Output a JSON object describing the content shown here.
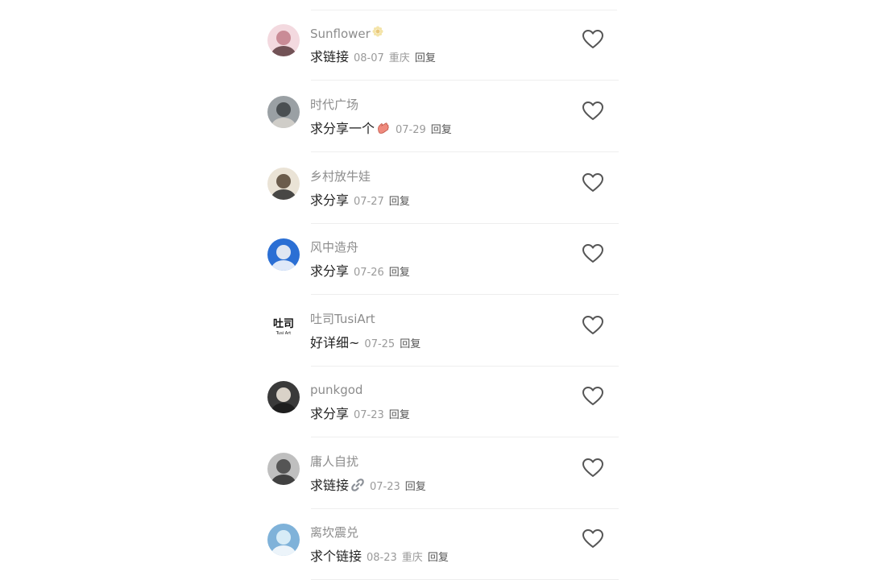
{
  "comments": [
    {
      "username": "Sunflower",
      "username_emoji": "sunflower-emoji-icon",
      "text": "求链接",
      "date": "08-07",
      "location": "重庆",
      "reply": "回复",
      "avatar_colors": [
        "#f3d9df",
        "#c98b96",
        "#5a3a3e"
      ]
    },
    {
      "username": "时代广场",
      "text": "求分享一个",
      "text_emoji": "peach-hand-emoji-icon",
      "date": "07-29",
      "location": "",
      "reply": "回复",
      "avatar_colors": [
        "#9aa0a4",
        "#4a4f52",
        "#d8d5cf"
      ]
    },
    {
      "username": "乡村放牛娃",
      "text": "求分享",
      "date": "07-27",
      "location": "",
      "reply": "回复",
      "avatar_colors": [
        "#eae3d6",
        "#6b5c4c",
        "#2b2b2b"
      ]
    },
    {
      "username": "风中造舟",
      "text": "求分享",
      "date": "07-26",
      "location": "",
      "reply": "回复",
      "avatar_colors": [
        "#2b6fd4",
        "#dfe6f2",
        "#ffffff"
      ]
    },
    {
      "username": "吐司TusiArt",
      "text": "好详细~",
      "date": "07-25",
      "location": "",
      "reply": "回复",
      "avatar_logo_text": "吐司",
      "avatar_logo_sub": "Tusi Art",
      "avatar_colors": [
        "#ffffff",
        "#111111",
        "#111111"
      ]
    },
    {
      "username": "punkgod",
      "text": "求分享",
      "date": "07-23",
      "location": "",
      "reply": "回复",
      "avatar_colors": [
        "#3a3a3a",
        "#d9d2c8",
        "#1a1a1a"
      ]
    },
    {
      "username": "庸人自扰",
      "text": "求链接",
      "text_emoji": "link-emoji-icon",
      "date": "07-23",
      "location": "",
      "reply": "回复",
      "avatar_colors": [
        "#bfbfbf",
        "#555555",
        "#2a2a2a"
      ]
    },
    {
      "username": "离坎震兑",
      "text": "求个链接",
      "date": "08-23",
      "location": "重庆",
      "reply": "回复",
      "avatar_colors": [
        "#7fb2d9",
        "#d7ecf7",
        "#ffffff"
      ]
    }
  ],
  "icons": {
    "like": "heart-outline-icon"
  },
  "colors": {
    "username": "#8c8c8c",
    "text": "#222222",
    "meta": "#9a9a9a",
    "divider": "#eeeeee",
    "heart_stroke": "#555555"
  }
}
